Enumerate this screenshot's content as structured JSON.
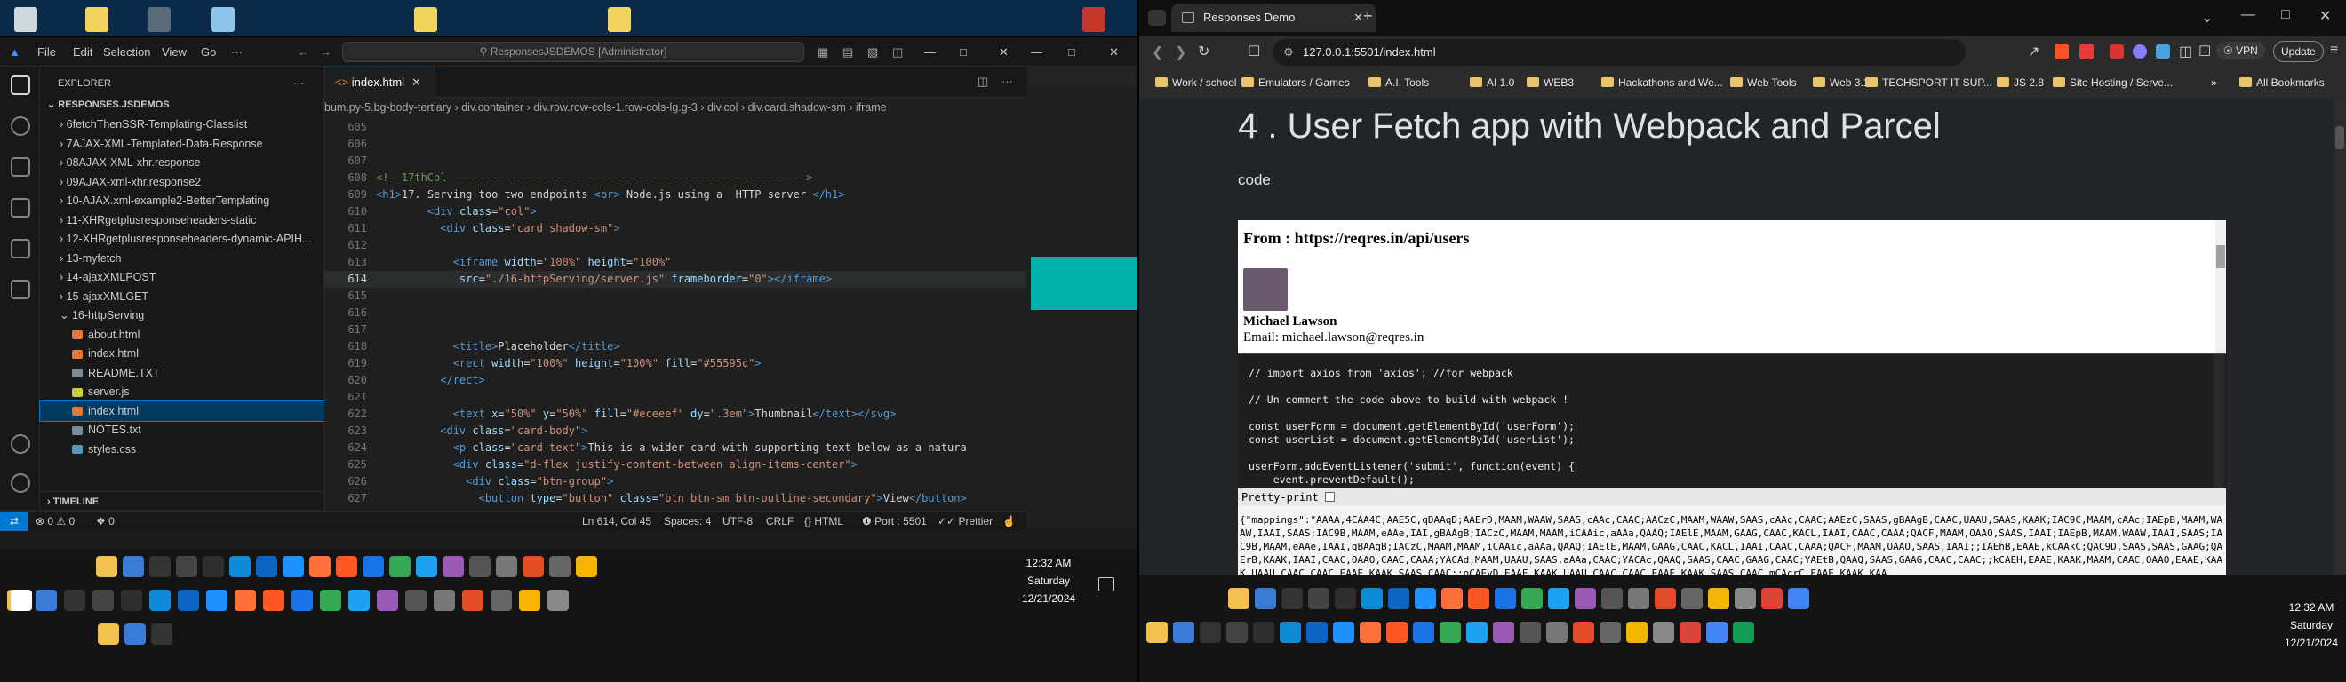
{
  "vscode": {
    "menu": [
      "File",
      "Edit",
      "Selection",
      "View",
      "Go"
    ],
    "search_text": "ResponsesJSDEMOS [Administrator]",
    "explorer_label": "EXPLORER",
    "root_folder": "RESPONSES.JSDEMOS",
    "files": [
      {
        "name": "6fetchThenSSR-Templating-Classlist",
        "type": "folder"
      },
      {
        "name": "7AJAX-XML-Templated-Data-Response",
        "type": "folder"
      },
      {
        "name": "08AJAX-XML-xhr.response",
        "type": "folder"
      },
      {
        "name": "09AJAX-xml-xhr.response2",
        "type": "folder"
      },
      {
        "name": "10-AJAX.xml-example2-BetterTemplating",
        "type": "folder"
      },
      {
        "name": "11-XHRgetplusresponseheaders-static",
        "type": "folder"
      },
      {
        "name": "12-XHRgetplusresponseheaders-dynamic-APIH...",
        "type": "folder"
      },
      {
        "name": "13-myfetch",
        "type": "folder"
      },
      {
        "name": "14-ajaxXMLPOST",
        "type": "folder"
      },
      {
        "name": "15-ajaxXMLGET",
        "type": "folder"
      },
      {
        "name": "16-httpServing",
        "type": "folder-open"
      },
      {
        "name": "about.html",
        "type": "html"
      },
      {
        "name": "index.html",
        "type": "html"
      },
      {
        "name": "README.TXT",
        "type": "txt"
      },
      {
        "name": "server.js",
        "type": "js"
      },
      {
        "name": "index.html",
        "type": "html-selected"
      },
      {
        "name": "NOTES.txt",
        "type": "txt"
      },
      {
        "name": "styles.css",
        "type": "css"
      }
    ],
    "timeline_label": "TIMELINE",
    "tab_label": "index.html",
    "breadcrumb": [
      "bum.py-5.bg-body-tertiary",
      "div.container",
      "div.row.row-cols-1.row-cols-lg.g-3",
      "div.col",
      "div.card.shadow-sm",
      "iframe"
    ],
    "code_lines": [
      {
        "n": "605",
        "t": ""
      },
      {
        "n": "606",
        "t": ""
      },
      {
        "n": "607",
        "t": ""
      },
      {
        "n": "608",
        "t": "<!--17thCol ---------------------------------------------------- -->"
      },
      {
        "n": "609",
        "t": "<h1>17. Serving too two endpoints <br> Node.js using a  HTTP server </h1>"
      },
      {
        "n": "610",
        "t": "        <div class=\"col\">"
      },
      {
        "n": "611",
        "t": "          <div class=\"card shadow-sm\">"
      },
      {
        "n": "612",
        "t": ""
      },
      {
        "n": "613",
        "t": "            <iframe width=\"100%\" height=\"100%\""
      },
      {
        "n": "614",
        "t": "             src=\"./16-httpServing/server.js\" frameborder=\"0\"></iframe>"
      },
      {
        "n": "615",
        "t": ""
      },
      {
        "n": "616",
        "t": ""
      },
      {
        "n": "617",
        "t": ""
      },
      {
        "n": "618",
        "t": "            <title>Placeholder</title>"
      },
      {
        "n": "619",
        "t": "            <rect width=\"100%\" height=\"100%\" fill=\"#55595c\">"
      },
      {
        "n": "620",
        "t": "          </rect>"
      },
      {
        "n": "621",
        "t": ""
      },
      {
        "n": "622",
        "t": "            <text x=\"50%\" y=\"50%\" fill=\"#eceeef\" dy=\".3em\">Thumbnail</text></svg>"
      },
      {
        "n": "623",
        "t": "          <div class=\"card-body\">"
      },
      {
        "n": "624",
        "t": "            <p class=\"card-text\">This is a wider card with supporting text below as a natura"
      },
      {
        "n": "625",
        "t": "            <div class=\"d-flex justify-content-between align-items-center\">"
      },
      {
        "n": "626",
        "t": "              <div class=\"btn-group\">"
      },
      {
        "n": "627",
        "t": "                <button type=\"button\" class=\"btn btn-sm btn-outline-secondary\">View</button>"
      }
    ],
    "status": {
      "errors": "0",
      "warnings": "0",
      "ports": "0",
      "position": "Ln 614, Col 45",
      "spaces": "Spaces: 4",
      "encoding": "UTF-8",
      "eol": "CRLF",
      "language": "HTML",
      "port": "Port : 5501",
      "prettier": "Prettier"
    }
  },
  "browser": {
    "tab_title": "Responses Demo",
    "url": "127.0.0.1:5501/index.html",
    "update_label": "Update",
    "vpn_label": "VPN",
    "bookmarks": [
      "Work / school",
      "Emulators / Games",
      "A.I. Tools",
      "AI 1.0",
      "WEB3",
      "Hackathons and We...",
      "Web Tools",
      "Web 3.1",
      "TECHSPORT IT SUP...",
      "JS 2.8",
      "Site Hosting / Serve..."
    ],
    "all_bookmarks": "All Bookmarks",
    "page": {
      "heading": "4 . User Fetch app with Webpack and Parcel",
      "subtext": "code",
      "frame_heading": "From : https://reqres.in/api/users",
      "user_name": "Michael Lawson",
      "user_email": "Email: michael.lawson@reqres.in",
      "source_lines": [
        "// import axios from 'axios'; //for webpack",
        "",
        "// Un comment the code above to build with webpack !",
        "",
        "const userForm = document.getElementById('userForm');",
        "const userList = document.getElementById('userList');",
        "",
        "userForm.addEventListener('submit', function(event) {",
        "    event.preventDefault();"
      ],
      "pretty_print_label": "Pretty-print",
      "json_text": "{\"mappings\":\"AAAA,4CAA4C;AAE5C,qDAAqD;AAErD,MAAM,WAAW,SAAS,cAAc,CAAC;AACzC,MAAM,WAAW,SAAS,cAAc,CAAC;AAEzC,SAAS,gBAAgB,CAAC,UAAU,SAAS,KAAK;IAC9C,MAAM,cAAc;IAEpB,MAAM,WAAW,IAAI,SAAS;IAC9B,MAAM,eAAe,IAI,gBAAgB;IACzC,MAAM,MAAM,iCAAic,aAAa,QAAQ;IAElE,MAAM,GAAG,CAAC,KACL,IAAI,CAAC,CAAA;QACF,MAAM,OAAO,SAAS,IAAI;IAEpB,MAAM,WAAW,IAAI,SAAS;IAC9B,MAAM,eAAe,IAAI,gBAAgB;IACzC,MAAM,MAAM,iCAAic,aAAa,QAAQ;IAElE,MAAM,GAAG,CAAC,KACL,IAAI,CAAC,CAAA;QACF,MAAM,OAAO,SAAS,IAAI;;IAEhB,EAAE,kCAAkC;QAC9D,SAAS,SAAS,GAAG;QAErB,KAAK,IAAI,CAAC,OAAO,CAAC,CAAA;YACAd,MAAM,UAAU,SAAS,aAAa,CAAC;YACAc,QAAQ,SAAS,CAAC,GAAG,CAAC;YAEtB,QAAQ,SAAS,GAAG,CAAC,CAAC;;kCAEH,EAAE,KAAK,MAAM,CAAC,OAAO,EAAE,KAAK,UAAU,CAAC,CAAC,EAAE,KAAK,SAAS,CAAC;;oCAEvD,EAAE,KAAK,UAAU,CAAC,CAAC,EAAE,KAAK,SAAS,CAAC,mCAcrC,EAAE,KAAK,KAA"
    }
  },
  "taskbar": {
    "left_time": "12:32 AM",
    "left_day": "Saturday",
    "left_date": "12/21/2024",
    "right_time": "12:32 AM",
    "right_day": "Saturday",
    "right_date": "12/21/2024"
  }
}
